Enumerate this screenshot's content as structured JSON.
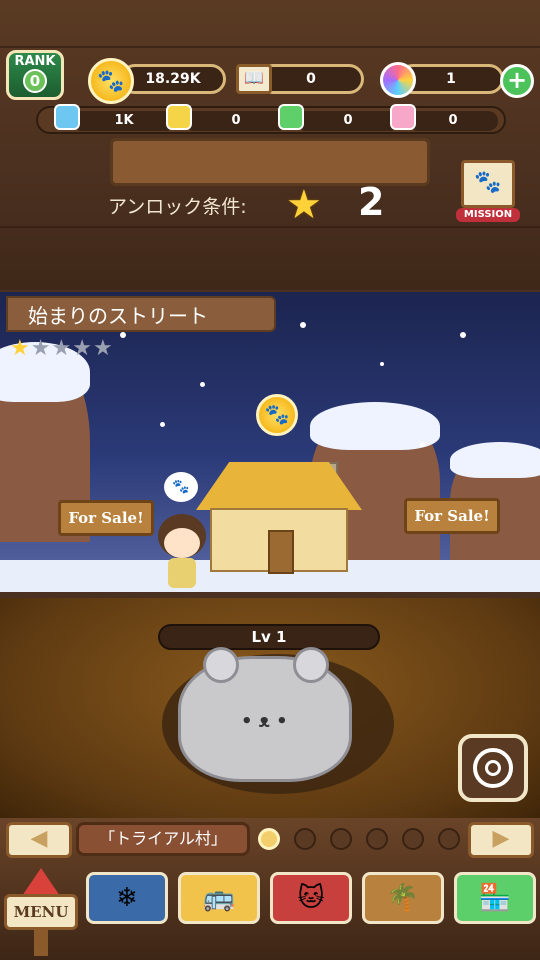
{
  "hud": {
    "rank_label": "RANK",
    "rank_value": "0",
    "coins": "18.29K",
    "books": "0",
    "candy": "1",
    "plus_symbol": "+"
  },
  "resources": [
    {
      "animal": "blue-cat",
      "color": "#6ec7f0",
      "value": "1K"
    },
    {
      "animal": "yellow-cat",
      "color": "#f6d447",
      "value": "0"
    },
    {
      "animal": "green-cat",
      "color": "#5fcf6a",
      "value": "0"
    },
    {
      "animal": "pink-pig",
      "color": "#f7a7c8",
      "value": "0"
    }
  ],
  "unlock": {
    "label": "アンロック条件:",
    "stars": "2",
    "star_glyph": "★"
  },
  "mission_label": "MISSION",
  "street": {
    "title": "始まりのストリート",
    "rating": 1,
    "max_rating": 5,
    "stars_text": "★★★★★",
    "for_sale_left": "For Sale!",
    "for_sale_right": "For Sale!"
  },
  "dig": {
    "level_text": "Lv 1"
  },
  "navigation": {
    "prev_arrow": "◀",
    "next_arrow": "▶",
    "village_name": "「トライアル村」",
    "page_count": 6,
    "active_page": 0
  },
  "menu_label": "MENU",
  "nav_tiles": [
    {
      "icon": "snowflake-icon",
      "glyph": "❄",
      "color": "#3a6aa8"
    },
    {
      "icon": "bus-icon",
      "glyph": "🚌",
      "color": "#f2c34a"
    },
    {
      "icon": "cat-face-icon",
      "glyph": "🐱",
      "color": "#c8403e"
    },
    {
      "icon": "tree-icon",
      "glyph": "🌴",
      "color": "#b8823e"
    },
    {
      "icon": "shop-icon",
      "glyph": "🏪",
      "color": "#5ccf6a"
    }
  ],
  "colors": {
    "accent_green": "#4cc25a",
    "coin_gold": "#f2a900",
    "wood": "#5a3a22"
  }
}
